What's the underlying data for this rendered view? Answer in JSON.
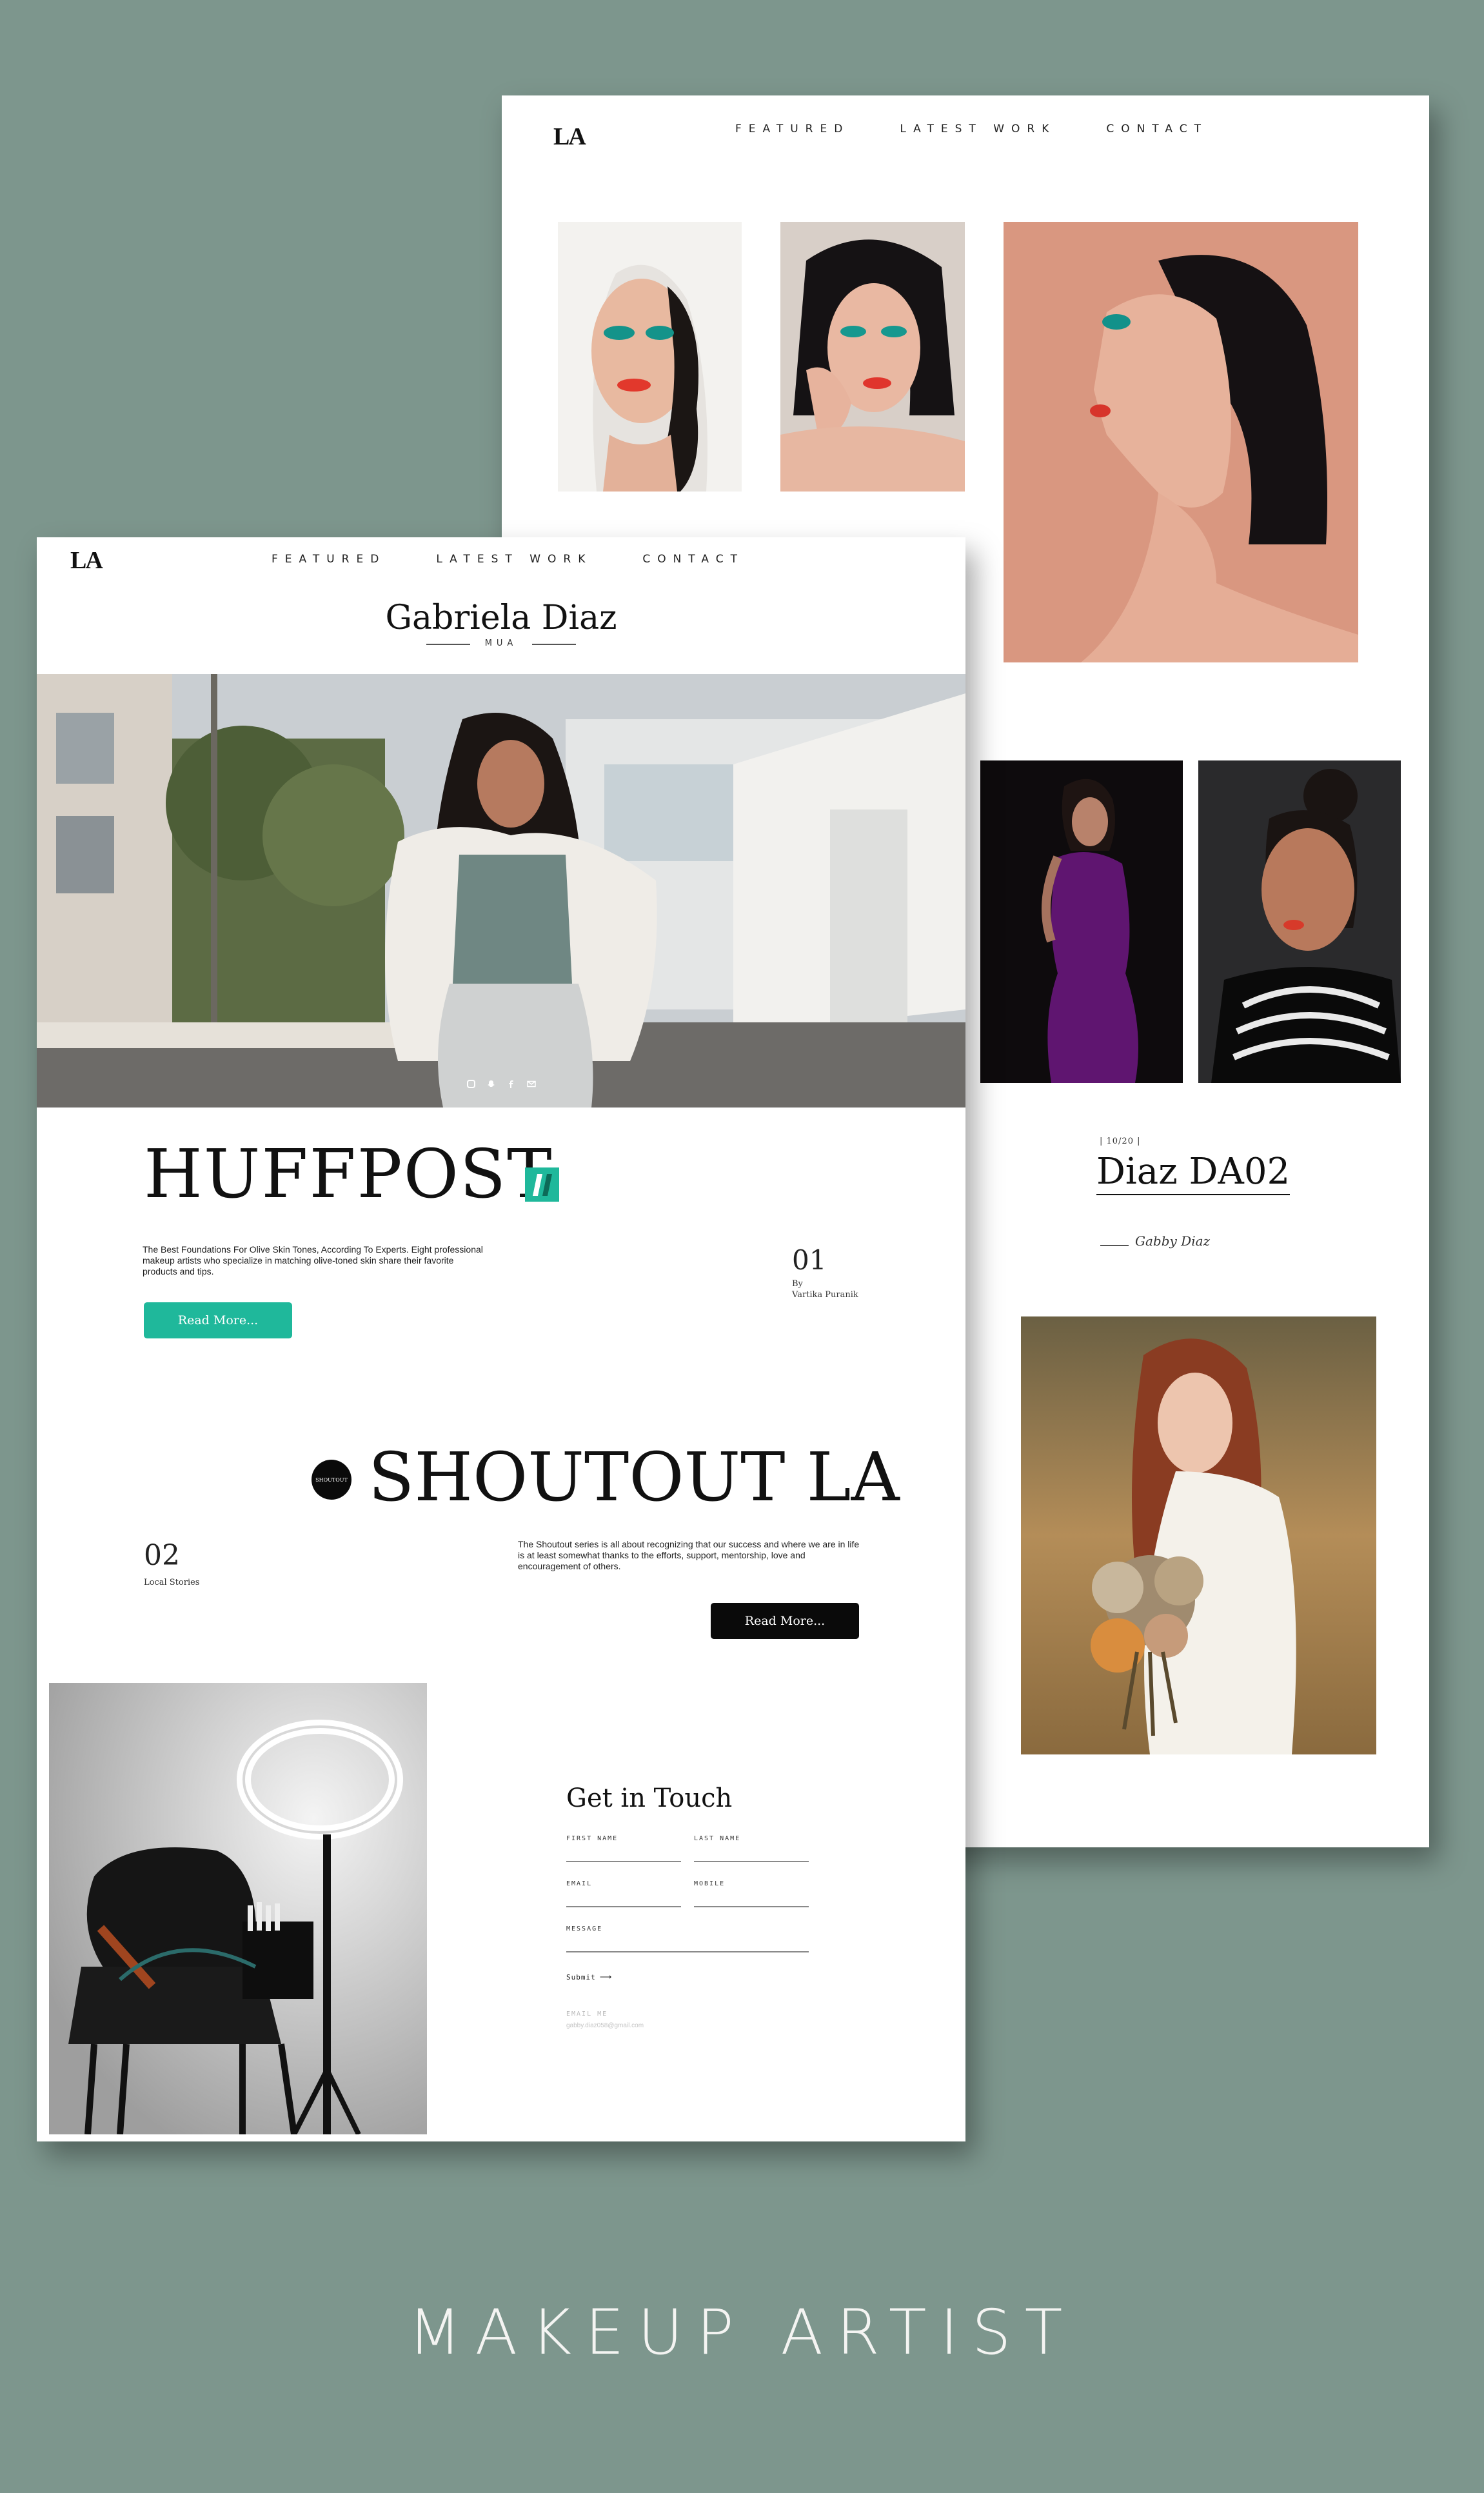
{
  "back_page": {
    "logo": "LA",
    "nav": [
      "FEATURED",
      "LATEST WORK",
      "CONTACT"
    ],
    "feature_date": "| 10/20 |",
    "feature_title": "Diaz DA02",
    "signature": "Gabby Diaz"
  },
  "front_page": {
    "logo": "LA",
    "nav": [
      "FEATURED",
      "LATEST WORK",
      "CONTACT"
    ],
    "brand_name": "Gabriela Diaz",
    "brand_sub": "MUA",
    "press1": {
      "title": "HUFFPOST",
      "desc": "The Best Foundations For Olive Skin Tones, According To Experts. Eight professional makeup artists who specialize in matching olive-toned skin share their favorite products and tips.",
      "number": "01",
      "by_label": "By",
      "author": "Vartika Puranik",
      "button": "Read More..."
    },
    "press2": {
      "badge": "SHOUTOUT",
      "title": "SHOUTOUT LA",
      "number": "02",
      "category": "Local Stories",
      "desc": "The Shoutout series is all about recognizing that our success and where we are in life is at least somewhat thanks to the efforts, support, mentorship, love and encouragement of others.",
      "button": "Read More..."
    },
    "contact": {
      "title": "Get in Touch",
      "first_name": "FIRST NAME",
      "last_name": "LAST NAME",
      "email": "EMAIL",
      "mobile": "MOBILE",
      "message": "MESSAGE",
      "submit": "Submit",
      "email_label": "EMAIL ME",
      "email_address": "gabby.diaz058@gmail.com"
    }
  },
  "caption": "MAKEUP ARTIST",
  "colors": {
    "background": "#7d968d",
    "accent": "#1fb89b",
    "black_button": "#0a0a0a"
  },
  "icons": [
    "instagram-icon",
    "snapchat-icon",
    "facebook-icon",
    "mail-icon"
  ]
}
